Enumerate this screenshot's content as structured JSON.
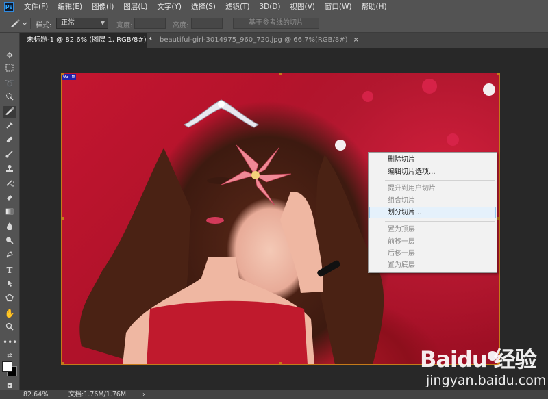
{
  "app": {
    "logo_text": "Ps"
  },
  "menu": [
    "文件(F)",
    "编辑(E)",
    "图像(I)",
    "图层(L)",
    "文字(Y)",
    "选择(S)",
    "滤镜(T)",
    "3D(D)",
    "视图(V)",
    "窗口(W)",
    "帮助(H)"
  ],
  "options_bar": {
    "tool_icon": "slice-select-icon",
    "style_label": "样式:",
    "style_value": "正常",
    "width_label": "宽度:",
    "height_label": "高度:",
    "guides_button": "基于参考线的切片"
  },
  "tabs": [
    {
      "label": "未标题-1 @ 82.6% (图层 1, RGB/8#) *",
      "close": "×"
    },
    {
      "label": "beautiful-girl-3014975_960_720.jpg @ 66.7%(RGB/8#)",
      "close": "×"
    }
  ],
  "tools": [
    "move-icon",
    "marquee-icon",
    "lasso-icon",
    "quick-select-icon",
    "slice-icon",
    "eyedropper-icon",
    "healing-brush-icon",
    "brush-icon",
    "clone-stamp-icon",
    "history-brush-icon",
    "eraser-icon",
    "gradient-icon",
    "blur-icon",
    "dodge-icon",
    "pen-icon",
    "type-icon",
    "path-select-icon",
    "shape-icon",
    "hand-icon",
    "zoom-icon",
    "more-tools-icon"
  ],
  "canvas": {
    "slice_badge": "03 ⊠"
  },
  "context_menu": {
    "items": [
      {
        "label": "删除切片",
        "enabled": true
      },
      {
        "label": "编辑切片选项...",
        "enabled": true
      },
      {
        "label": "提升到用户切片",
        "enabled": false
      },
      {
        "label": "组合切片",
        "enabled": false
      },
      {
        "label": "划分切片...",
        "enabled": true,
        "highlighted": true
      },
      {
        "label": "置为顶层",
        "enabled": false
      },
      {
        "label": "前移一层",
        "enabled": false
      },
      {
        "label": "后移一层",
        "enabled": false
      },
      {
        "label": "置为底层",
        "enabled": false
      }
    ]
  },
  "status": {
    "zoom": "82.64%",
    "doc": "文档:1.76M/1.76M",
    "arrow": "›"
  },
  "watermark": {
    "logo": "Baidu 经验",
    "url": "jingyan.baidu.com"
  },
  "colors": {
    "accent_slice": "#c47b1a",
    "menu_highlight": "#e5f1fb"
  }
}
